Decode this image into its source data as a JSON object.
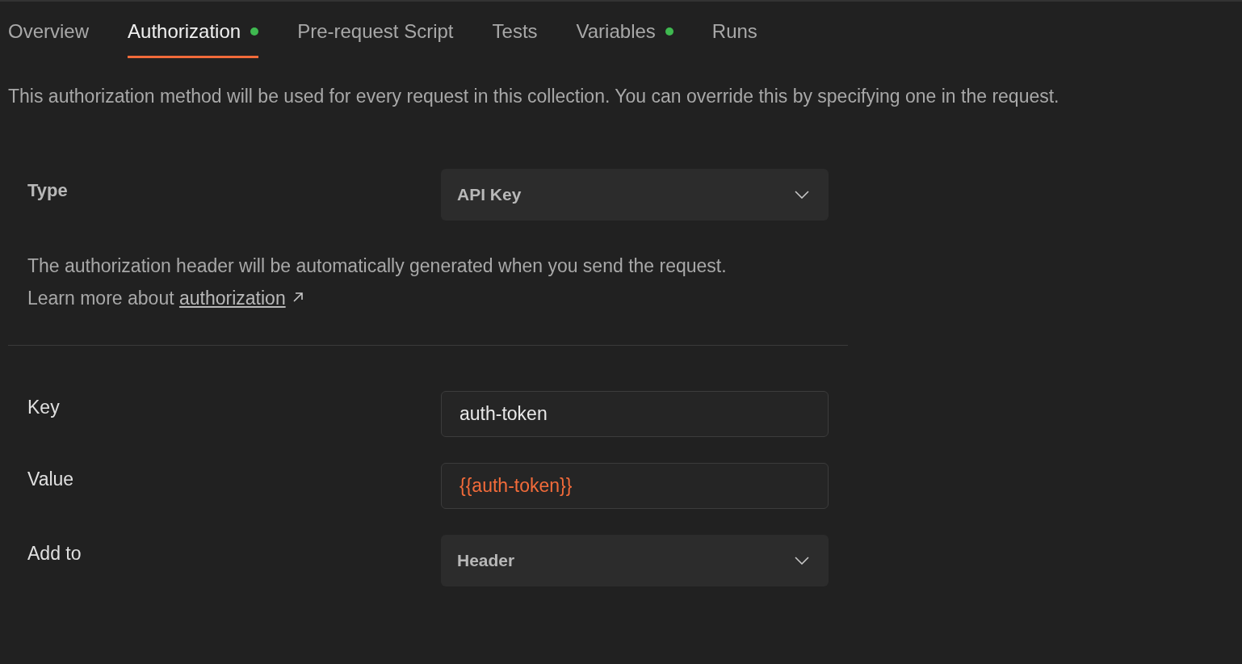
{
  "tabs": [
    {
      "label": "Overview",
      "selected": false,
      "dot": false
    },
    {
      "label": "Authorization",
      "selected": true,
      "dot": true
    },
    {
      "label": "Pre-request Script",
      "selected": false,
      "dot": false
    },
    {
      "label": "Tests",
      "selected": false,
      "dot": false
    },
    {
      "label": "Variables",
      "selected": false,
      "dot": true
    },
    {
      "label": "Runs",
      "selected": false,
      "dot": false
    }
  ],
  "description": "This authorization method will be used for every request in this collection. You can override this by specifying one in the request.",
  "type": {
    "label": "Type",
    "value": "API Key"
  },
  "help": {
    "text": "The authorization header will be automatically generated when you send the request. Learn more about",
    "link": "authorization"
  },
  "fields": [
    {
      "kind": "input",
      "label": "Key",
      "value": "auth-token",
      "variable": false
    },
    {
      "kind": "input",
      "label": "Value",
      "value": "{{auth-token}}",
      "variable": true
    },
    {
      "kind": "select",
      "label": "Add to",
      "value": "Header"
    }
  ]
}
